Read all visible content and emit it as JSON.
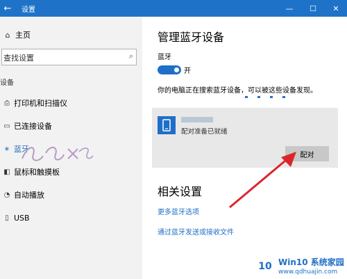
{
  "titlebar": {
    "back": "←",
    "title": "设置",
    "minimize": "—",
    "maximize": "☐",
    "close": "✕"
  },
  "sidebar": {
    "home": "主页",
    "search_placeholder": "查找设置",
    "section": "设备",
    "items": [
      {
        "label": "打印机和扫描仪",
        "icon": "printer-icon",
        "glyph": "⎙"
      },
      {
        "label": "已连接设备",
        "icon": "connected-devices-icon",
        "glyph": "▭"
      },
      {
        "label": "蓝牙",
        "icon": "bluetooth-icon",
        "glyph": "∗"
      },
      {
        "label": "鼠标和触摸板",
        "icon": "mouse-icon",
        "glyph": "◧"
      },
      {
        "label": "自动播放",
        "icon": "autoplay-icon",
        "glyph": "◔"
      },
      {
        "label": "USB",
        "icon": "usb-icon",
        "glyph": "▯"
      }
    ]
  },
  "main": {
    "title": "管理蓝牙设备",
    "bluetooth_label": "蓝牙",
    "toggle_state": "开",
    "scan_text": "你的电脑正在搜索蓝牙设备，可以被这些设备发现。",
    "device": {
      "status": "配对准备已就绪",
      "pair_button": "配对"
    },
    "related_title": "相关设置",
    "links": [
      "更多蓝牙选项",
      "通过蓝牙发送或接收文件"
    ]
  },
  "watermark": {
    "name": "Win10 系统家园",
    "url": "www.qdhuajin.com",
    "logo": "10"
  },
  "colors": {
    "accent": "#1f6fc8",
    "arrow": "#d9262c",
    "sidebar_bg": "#f2f2f2"
  }
}
